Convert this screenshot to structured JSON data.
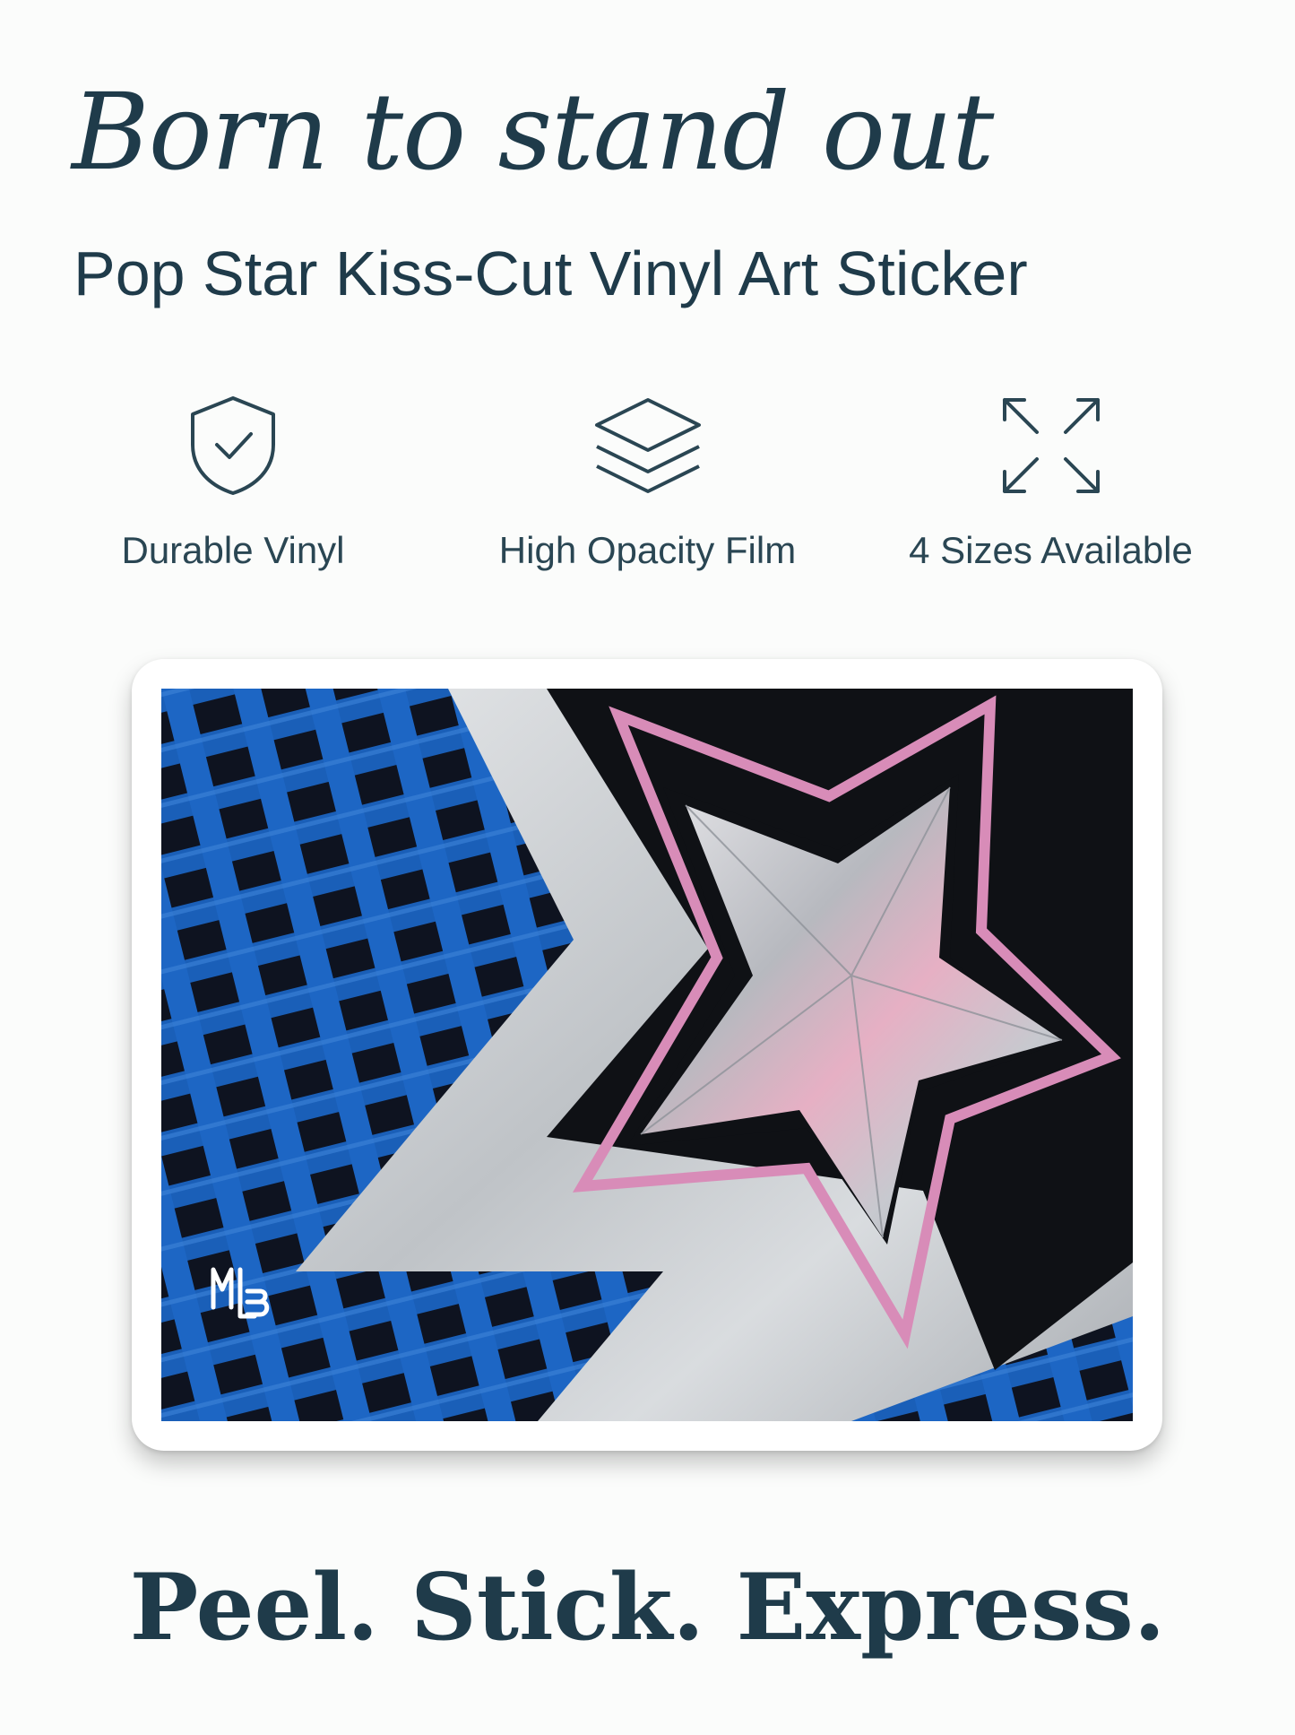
{
  "headline": "Born to stand out",
  "subtitle": "Pop Star Kiss-Cut Vinyl Art Sticker",
  "features": [
    {
      "icon": "shield-check-icon",
      "label": "Durable Vinyl"
    },
    {
      "icon": "layers-icon",
      "label": "High Opacity Film"
    },
    {
      "icon": "expand-arrows-icon",
      "label": "4 Sizes Available"
    }
  ],
  "artwork": {
    "signature": "MLB",
    "colors": {
      "blue": "#1a5fb8",
      "black": "#0f1115",
      "silver": "#c9ccd0",
      "pink": "#d88cb8"
    }
  },
  "tagline": "Peel. Stick. Express.",
  "colors": {
    "text": "#1f3b4a",
    "background": "#fbfcfb"
  }
}
